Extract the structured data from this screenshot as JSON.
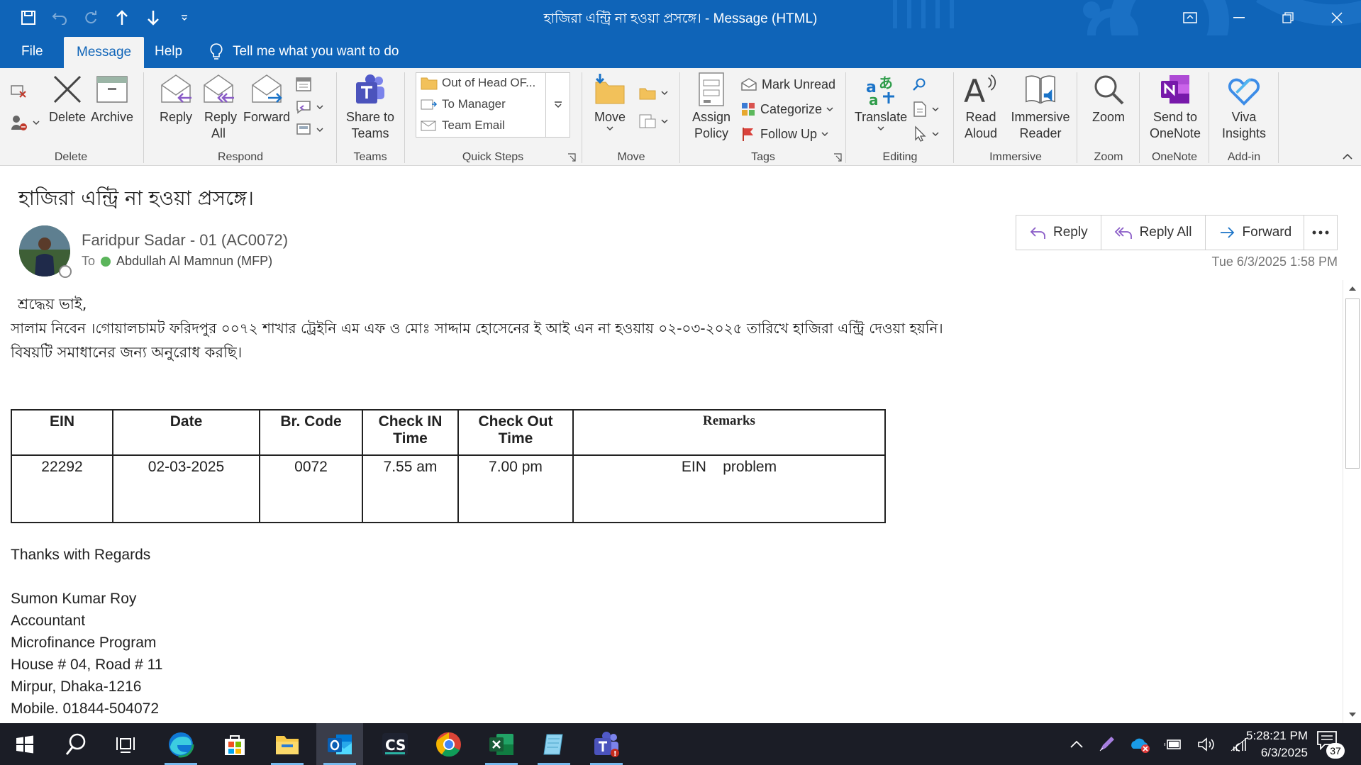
{
  "window": {
    "title": "হাজিরা এন্ট্রি না হওয়া প্রসঙ্গে। - Message (HTML)"
  },
  "menu": {
    "tabs": [
      "File",
      "Message",
      "Help"
    ],
    "active_tab": "Message",
    "tell_me": "Tell me what you want to do"
  },
  "ribbon": {
    "delete": {
      "delete_label": "Delete",
      "archive_label": "Archive",
      "group_label": "Delete"
    },
    "respond": {
      "reply_label": "Reply",
      "reply_all_label": "Reply All",
      "forward_label": "Forward",
      "group_label": "Respond"
    },
    "teams": {
      "share_label": "Share to Teams",
      "group_label": "Teams"
    },
    "quick_steps": {
      "items": [
        "Out of Head OF...",
        "To Manager",
        "Team Email"
      ],
      "group_label": "Quick Steps"
    },
    "move": {
      "move_label": "Move",
      "group_label": "Move"
    },
    "tags": {
      "assign_policy_label": "Assign Policy",
      "mark_unread_label": "Mark Unread",
      "categorize_label": "Categorize",
      "follow_up_label": "Follow Up",
      "group_label": "Tags"
    },
    "editing": {
      "translate_label": "Translate",
      "group_label": "Editing"
    },
    "immersive": {
      "read_aloud_label": "Read Aloud",
      "immersive_reader_label": "Immersive Reader",
      "group_label": "Immersive"
    },
    "zoom": {
      "zoom_label": "Zoom",
      "group_label": "Zoom"
    },
    "onenote": {
      "send_label": "Send to OneNote",
      "group_label": "OneNote"
    },
    "addin": {
      "viva_label": "Viva Insights",
      "group_label": "Add-in"
    }
  },
  "message": {
    "subject": "হাজিরা এন্ট্রি না হওয়া প্রসঙ্গে।",
    "sender": "Faridpur Sadar - 01 (AC0072)",
    "to_label": "To",
    "recipient": "Abdullah Al Mamnun (MFP)",
    "date": "Tue 6/3/2025 1:58 PM",
    "actions": {
      "reply": "Reply",
      "reply_all": "Reply All",
      "forward": "Forward",
      "more": "..."
    },
    "greeting": " শ্রদ্ধেয় ভাই,",
    "line1": "সালাম নিবেন ।গোয়ালচামট ফরিদপুর ০০৭২ শাখার ট্রেইনি এম এফ ও মোঃ সাদ্দাম হোসেনের ই আই এন না হওয়ায় ০২-০৩-২০২৫ তারিখে হাজিরা এন্ট্রি দেওয়া হয়নি।",
    "line2": "বিষয়টি সমাধানের জন্য অনুরোধ করছি।",
    "table": {
      "headers": [
        "EIN",
        "Date",
        "Br. Code",
        "Check IN Time",
        "Check Out Time",
        "Remarks"
      ],
      "rows": [
        [
          "22292",
          "02-03-2025",
          "0072",
          "7.55 am",
          "7.00 pm",
          "EIN    problem"
        ]
      ]
    },
    "signature": {
      "thanks": "Thanks with Regards",
      "name": "Sumon Kumar Roy",
      "title": "Accountant",
      "org": "Microfinance Program",
      "address1": "House # 04, Road # 11",
      "address2": "Mirpur, Dhaka-1216",
      "mobile": "Mobile. 01844-504072"
    }
  },
  "taskbar": {
    "time": "5:28:21 PM",
    "date": "6/3/2025",
    "notification_count": "37",
    "apps": [
      "start-icon",
      "search-icon",
      "task-view-icon",
      "edge-icon",
      "store-icon",
      "file-explorer-icon",
      "outlook-icon",
      "cs-app-icon",
      "chrome-icon",
      "excel-icon",
      "notepad-icon",
      "teams-icon"
    ]
  },
  "colors": {
    "accent": "#0f64b8",
    "ribbon_bg": "#f3f3f3",
    "taskbar_bg": "#1b1d26"
  }
}
